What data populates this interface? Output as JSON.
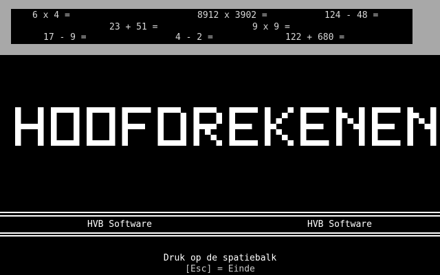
{
  "sums": [
    "6 x 4 =",
    "8912 x 3902 =",
    "124 - 48 =",
    "23 + 51 =",
    "9 x 9 =",
    "17 - 9 =",
    "4 - 2 =",
    "122 + 680 ="
  ],
  "title": "HOOFDREKENEN",
  "credits": {
    "left": "HVB Software",
    "right": "HVB Software"
  },
  "footer": {
    "prompt": "Druk op de spatiebalk",
    "exit": "[Esc] = Einde"
  },
  "colors": {
    "background": "#000000",
    "frame": "#a8a8a8",
    "text": "#ffffff",
    "sum_text": "#d8d8d8",
    "exit_text": "#c8c8c8"
  }
}
